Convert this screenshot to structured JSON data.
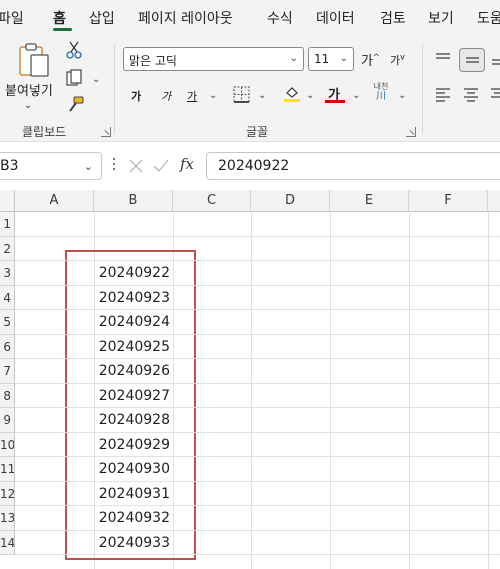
{
  "menu": {
    "tabs": [
      "파일",
      "홈",
      "삽입",
      "페이지 레이아웃",
      "수식",
      "데이터",
      "검토",
      "보기",
      "도움"
    ],
    "active_tab": "홈"
  },
  "ribbon": {
    "clipboard": {
      "paste_label": "붙여넣기",
      "group_label": "클립보드"
    },
    "font": {
      "font_name": "맑은 고딕",
      "font_size": "11",
      "bold": "가",
      "italic": "가",
      "underline": "가",
      "font_color_glyph": "가",
      "phonetic_top": "내천",
      "phonetic_bottom": "川",
      "grow_glyph": "가",
      "shrink_glyph": "가",
      "group_label": "글꼴"
    },
    "colors": {
      "highlight": "#ffe600",
      "font_color": "#e00000",
      "accent": "#1e6e3a"
    }
  },
  "formula_bar": {
    "name_box": "B3",
    "fx_label": "fx",
    "formula": "20240922"
  },
  "sheet": {
    "columns": [
      "A",
      "B",
      "C",
      "D",
      "E",
      "F"
    ],
    "rows": [
      "1",
      "2",
      "3",
      "4",
      "5",
      "6",
      "7",
      "8",
      "9",
      "10",
      "11",
      "12",
      "13",
      "14"
    ],
    "column_b_values": [
      "20240922",
      "20240923",
      "20240924",
      "20240925",
      "20240926",
      "20240927",
      "20240928",
      "20240929",
      "20240930",
      "20240931",
      "20240932",
      "20240933"
    ],
    "highlight_color": "#c0504d"
  }
}
